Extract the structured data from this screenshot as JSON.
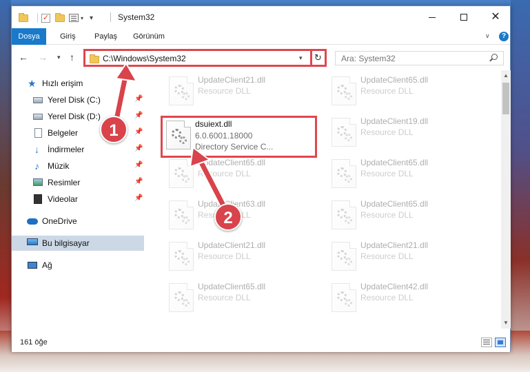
{
  "window": {
    "title": "System32"
  },
  "ribbon": {
    "tabs": [
      "Dosya",
      "Giriş",
      "Paylaş",
      "Görünüm"
    ]
  },
  "navbar": {
    "address": "C:\\Windows\\System32",
    "search_placeholder": "Ara: System32"
  },
  "sidebar": {
    "items": [
      {
        "label": "Hızlı erişim",
        "icon": "star-icon"
      },
      {
        "label": "Yerel Disk (C:)",
        "icon": "drive-icon",
        "pinned": true
      },
      {
        "label": "Yerel Disk (D:)",
        "icon": "drive-icon",
        "pinned": true
      },
      {
        "label": "Belgeler",
        "icon": "documents-icon",
        "pinned": true
      },
      {
        "label": "İndirmeler",
        "icon": "download-icon",
        "pinned": true
      },
      {
        "label": "Müzik",
        "icon": "music-icon",
        "pinned": true
      },
      {
        "label": "Resimler",
        "icon": "pictures-icon",
        "pinned": true
      },
      {
        "label": "Videolar",
        "icon": "video-icon",
        "pinned": true
      },
      {
        "label": "OneDrive",
        "icon": "onedrive-icon"
      },
      {
        "label": "Bu bilgisayar",
        "icon": "computer-icon",
        "selected": true
      },
      {
        "label": "Ağ",
        "icon": "network-icon"
      }
    ]
  },
  "files": {
    "left": [
      {
        "name": "UpdateClient21.dll",
        "type": "Resource DLL"
      },
      {
        "name": "dsuiext.dll",
        "version": "6.0.6001.18000",
        "type": "Directory Service C...",
        "highlighted": true
      },
      {
        "name": "UpdateClient65.dll",
        "type": "Resource DLL"
      },
      {
        "name": "UpdateClient63.dll",
        "type": "Resource DLL"
      },
      {
        "name": "UpdateClient21.dll",
        "type": "Resource DLL"
      },
      {
        "name": "UpdateClient65.dll",
        "type": "Resource DLL"
      }
    ],
    "right": [
      {
        "name": "UpdateClient65.dll",
        "type": "Resource DLL"
      },
      {
        "name": "UpdateClient19.dll",
        "type": "Resource DLL"
      },
      {
        "name": "UpdateClient65.dll",
        "type": "Resource DLL"
      },
      {
        "name": "UpdateClient65.dll",
        "type": "Resource DLL"
      },
      {
        "name": "UpdateClient21.dll",
        "type": "Resource DLL"
      },
      {
        "name": "UpdateClient42.dll",
        "type": "Resource DLL"
      }
    ]
  },
  "status": {
    "count": "161 öğe"
  },
  "callouts": [
    "1",
    "2"
  ],
  "colors": {
    "accent": "#1979ca",
    "highlight": "#e0464d",
    "callout": "#d9434b"
  }
}
